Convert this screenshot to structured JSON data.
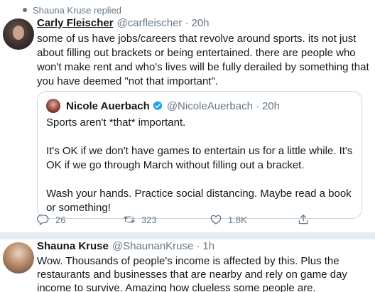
{
  "context": {
    "label": "Shauna Kruse replied"
  },
  "tweet": {
    "author_name": "Carly Fleischer",
    "author_handle": "@carfleischer",
    "separator": "·",
    "time": "20h",
    "text": "some of us have jobs/careers that revolve around sports. its not just about filling out brackets or being entertained. there are people who won't make rent and who's lives will be fully derailed by something that you have deemed \"not that important\".",
    "quote": {
      "author_name": "Nicole Auerbach",
      "verified_icon": "verified-badge-icon",
      "author_handle": "@NicoleAuerbach",
      "separator": "·",
      "time": "20h",
      "paragraphs": [
        "Sports aren't *that* important.",
        "It's OK if we don't have games to entertain us for a little while. It's OK if we go through March without filling out a bracket.",
        "Wash your hands. Practice social distancing. Maybe read a book or something!"
      ]
    },
    "actions": {
      "reply_icon": "reply-icon",
      "reply_count": "26",
      "retweet_icon": "retweet-icon",
      "retweet_count": "323",
      "like_icon": "heart-icon",
      "like_count": "1.8K",
      "share_icon": "share-icon"
    }
  },
  "reply": {
    "author_name": "Shauna Kruse",
    "author_handle": "@ShaunanKruse",
    "separator": "·",
    "time": "1h",
    "text": "Wow. Thousands of people's income is affected by this. Plus the restaurants and businesses that are nearby and rely on game day income to survive. Amazing how clueless some people are."
  },
  "colors": {
    "text": "#14171a",
    "secondary": "#657786",
    "verified": "#1da1f2",
    "divider": "#e6ecf0",
    "border": "#ccd6dd"
  }
}
